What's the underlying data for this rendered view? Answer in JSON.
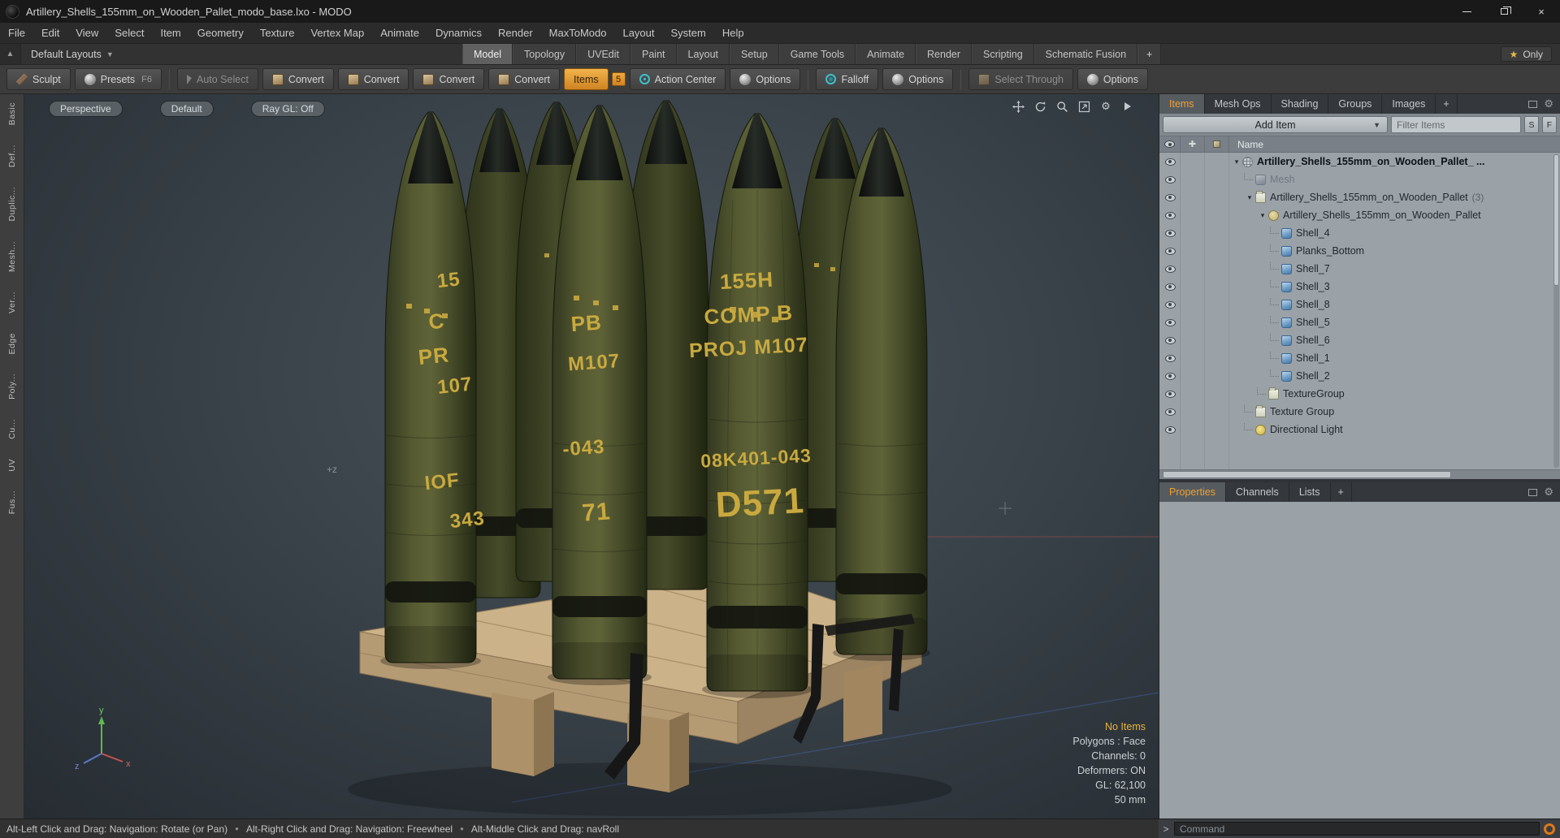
{
  "colors": {
    "accent_orange": "#f0a030",
    "marking_yellow": "#c9a93f",
    "shell_olive": "#51562f",
    "pallet_wood": "#ccb289"
  },
  "window": {
    "title": "Artillery_Shells_155mm_on_Wooden_Pallet_modo_base.lxo - MODO"
  },
  "menubar": {
    "items": [
      "File",
      "Edit",
      "View",
      "Select",
      "Item",
      "Geometry",
      "Texture",
      "Vertex Map",
      "Animate",
      "Dynamics",
      "Render",
      "MaxToModo",
      "Layout",
      "System",
      "Help"
    ]
  },
  "layoutbar": {
    "layouts_dropdown": "Default Layouts",
    "tabs": [
      "Model",
      "Topology",
      "UVEdit",
      "Paint",
      "Layout",
      "Setup",
      "Game Tools",
      "Animate",
      "Render",
      "Scripting",
      "Schematic Fusion"
    ],
    "add_tab": "+",
    "only_button": "Only"
  },
  "toolbar": {
    "sculpt": "Sculpt",
    "presets": "Presets",
    "presets_key": "F6",
    "auto_select": "Auto Select",
    "convert": "Convert",
    "items": "Items",
    "items_badge": "5",
    "action_center": "Action Center",
    "options": "Options",
    "falloff": "Falloff",
    "select_through": "Select Through"
  },
  "left_tabs": [
    "Basic",
    "Def...",
    "Duplic...",
    "Mesh...",
    "Ver...",
    "Edge",
    "Poly...",
    "Cu...",
    "UV",
    "Fus..."
  ],
  "viewport": {
    "view_button": "Perspective",
    "shading_button": "Default",
    "raygl_button": "Ray GL: Off",
    "axis_hint": "+z",
    "gizmo": {
      "x": "x",
      "y": "y",
      "z": "z"
    },
    "stats": {
      "selection": "No Items",
      "polygons": "Polygons : Face",
      "channels": "Channels: 0",
      "deformers": "Deformers: ON",
      "gl": "GL: 62,100",
      "grid_size": "50 mm"
    }
  },
  "scene": {
    "front_shell_markings": [
      "155H",
      "COMP B",
      "PROJ M107",
      "08K401-043",
      "D571"
    ],
    "left_shell_markings": [
      "15",
      "C",
      "PR",
      "107",
      "IOF",
      "343"
    ],
    "mid_shell_markings": [
      "PB",
      "M107",
      "-043",
      "71"
    ]
  },
  "right_panel": {
    "tabs": [
      "Items",
      "Mesh Ops",
      "Shading",
      "Groups",
      "Images"
    ],
    "add_tab": "+",
    "add_item_button": "Add Item",
    "filter_placeholder": "Filter Items",
    "filter_s": "S",
    "filter_f": "F",
    "name_header": "Name",
    "tree": [
      {
        "label": "Artillery_Shells_155mm_on_Wooden_Pallet_ ..."
      },
      {
        "label": "Mesh"
      },
      {
        "label": "Artillery_Shells_155mm_on_Wooden_Pallet",
        "suffix": "(3)"
      },
      {
        "label": "Artillery_Shells_155mm_on_Wooden_Pallet"
      },
      {
        "label": "Shell_4"
      },
      {
        "label": "Planks_Bottom"
      },
      {
        "label": "Shell_7"
      },
      {
        "label": "Shell_3"
      },
      {
        "label": "Shell_8"
      },
      {
        "label": "Shell_5"
      },
      {
        "label": "Shell_6"
      },
      {
        "label": "Shell_1"
      },
      {
        "label": "Shell_2"
      },
      {
        "label": "TextureGroup"
      },
      {
        "label": "Texture Group"
      },
      {
        "label": "Directional Light"
      }
    ]
  },
  "bottom_panel": {
    "tabs": [
      "Properties",
      "Channels",
      "Lists"
    ],
    "add_tab": "+"
  },
  "command": {
    "prompt": ">",
    "placeholder": "Command"
  },
  "statusbar": {
    "segments": [
      "Alt-Left Click and Drag: Navigation: Rotate (or Pan)",
      "Alt-Right Click and Drag: Navigation: Freewheel",
      "Alt-Middle Click and Drag: navRoll"
    ]
  }
}
